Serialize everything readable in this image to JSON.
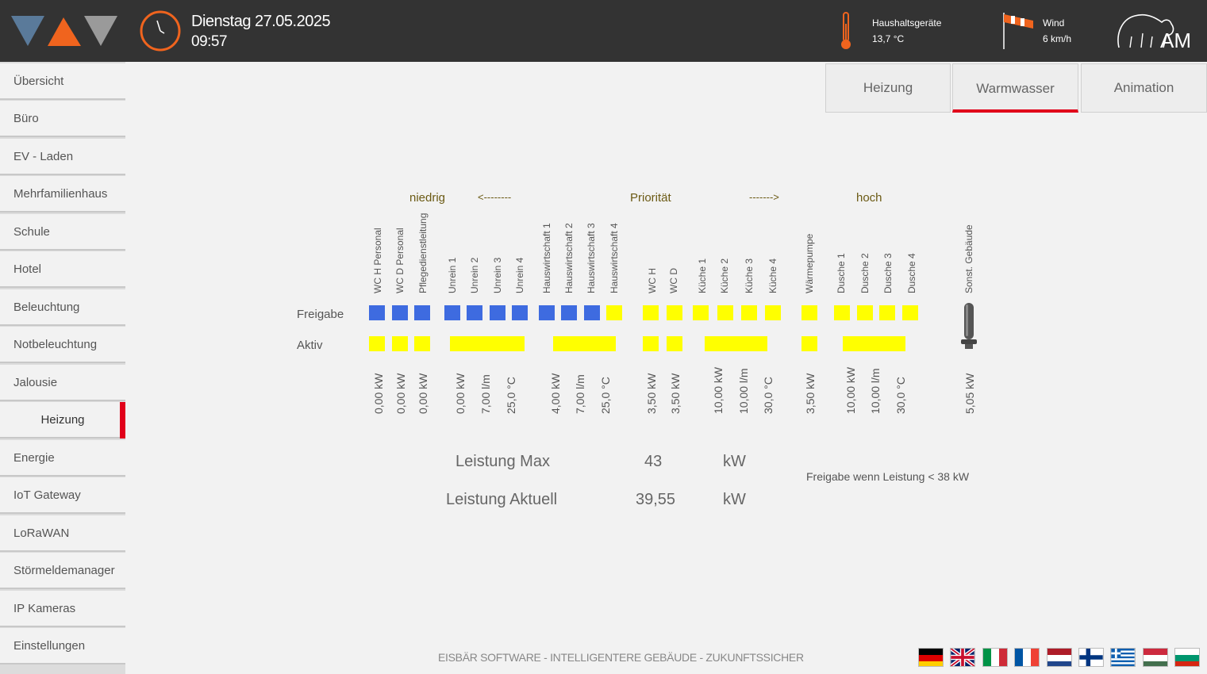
{
  "header": {
    "date": "Dienstag 27.05.2025",
    "time": "09:57",
    "temp_label": "Haushaltsgeräte",
    "temp_value": "13,7 °C",
    "wind_label": "Wind",
    "wind_value": "6 km/h",
    "brand_text": "AM",
    "colors": {
      "blue_gray": "#5a7a9a",
      "orange": "#f0641e",
      "gray": "#9a9a9a"
    }
  },
  "sidebar": {
    "items": [
      {
        "label": "Übersicht"
      },
      {
        "label": "Büro"
      },
      {
        "label": "EV - Laden"
      },
      {
        "label": "Mehrfamilienhaus"
      },
      {
        "label": "Schule"
      },
      {
        "label": "Hotel"
      },
      {
        "label": "Beleuchtung"
      },
      {
        "label": "Notbeleuchtung"
      },
      {
        "label": "Jalousie"
      },
      {
        "label": "Heizung",
        "active": true
      },
      {
        "label": "Energie"
      },
      {
        "label": "IoT Gateway"
      },
      {
        "label": "LoRaWAN"
      },
      {
        "label": "Störmeldemanager"
      },
      {
        "label": "IP Kameras"
      },
      {
        "label": "Einstellungen"
      }
    ]
  },
  "tabs": [
    {
      "label": "Heizung"
    },
    {
      "label": "Warmwasser",
      "active": true
    },
    {
      "label": "Animation"
    }
  ],
  "priority": {
    "low": "niedrig",
    "arrow_left": "<--------",
    "label": "Priorität",
    "arrow_right": "------->",
    "high": "hoch"
  },
  "rows": {
    "freigabe": "Freigabe",
    "aktiv": "Aktiv"
  },
  "consumers": [
    "WC H Personal",
    "WC D Personal",
    "Pflegedienstleitung",
    "Unrein 1",
    "Unrein 2",
    "Unrein 3",
    "Unrein 4",
    "Hauswirtschaft 1",
    "Hauswirtschaft 2",
    "Hauswirtschaft 3",
    "Hauswirtschaft 4",
    "WC H",
    "WC D",
    "Küche 1",
    "Küche 2",
    "Küche 3",
    "Küche 4",
    "Wärmepumpe",
    "Dusche 1",
    "Dusche 2",
    "Dusche 3",
    "Dusche 4",
    "Sonst. Gebäude"
  ],
  "freigabe_states": [
    "on",
    "on",
    "on",
    "on",
    "on",
    "on",
    "on",
    "on",
    "on",
    "on",
    "off",
    "off",
    "off",
    "off",
    "off",
    "off",
    "off",
    "off",
    "off",
    "off",
    "off",
    "off"
  ],
  "values": [
    "0,00 kW",
    "0,00 kW",
    "0,00 kW",
    "0,00 kW",
    "7,00 l/m",
    "25,0 °C",
    "4,00 kW",
    "7,00 l/m",
    "25,0 °C",
    "3,50 kW",
    "3,50 kW",
    "10,00 kW",
    "10,00 l/m",
    "30,0 °C",
    "3,50 kW",
    "10,00 kW",
    "10,00 l/m",
    "30,0 °C",
    "5,05 kW"
  ],
  "summary": {
    "max_label": "Leistung Max",
    "max_value": "43",
    "max_unit": "kW",
    "cur_label": "Leistung Aktuell",
    "cur_value": "39,55",
    "cur_unit": "kW",
    "note": "Freigabe wenn Leistung < 38 kW"
  },
  "footer": {
    "text": "EISBÄR SOFTWARE - INTELLIGENTERE GEBÄUDE - ZUKUNFTSSICHER"
  },
  "languages": [
    {
      "code": "de"
    },
    {
      "code": "en"
    },
    {
      "code": "it"
    },
    {
      "code": "fr"
    },
    {
      "code": "nl"
    },
    {
      "code": "fi"
    },
    {
      "code": "gr"
    },
    {
      "code": "hu"
    },
    {
      "code": "bg"
    }
  ],
  "colors": {
    "accent_red": "#e1001a",
    "freigabe_on": "#3e6be0",
    "freigabe_off": "#ffff00",
    "aktiv": "#ffff00"
  }
}
